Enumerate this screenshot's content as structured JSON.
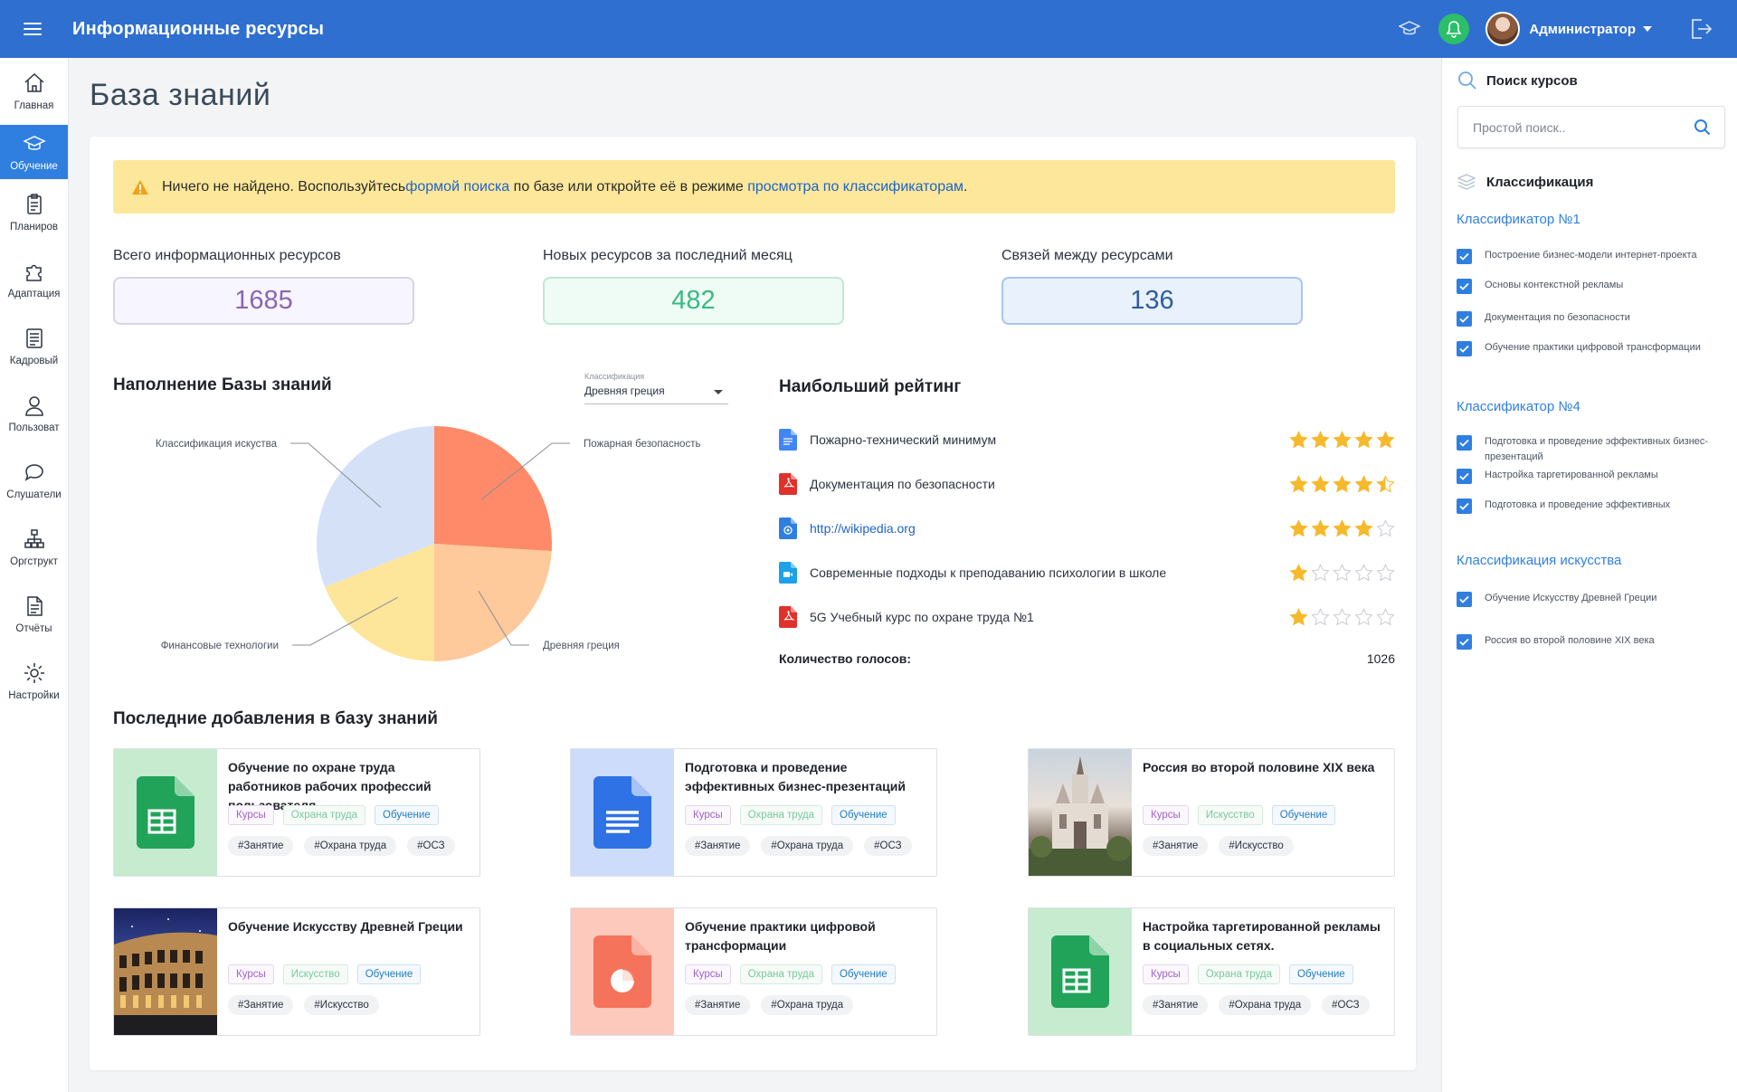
{
  "header": {
    "title": "Информационные ресурсы",
    "user_name": "Администратор"
  },
  "nav": {
    "items": [
      {
        "label": "Главная",
        "icon": "home-icon"
      },
      {
        "label": "Обучение",
        "icon": "graduation-cap-icon",
        "active": true
      },
      {
        "label": "Планиров",
        "icon": "clipboard-icon"
      },
      {
        "label": "Адаптация",
        "icon": "puzzle-icon"
      },
      {
        "label": "Кадровый",
        "icon": "document-list-icon"
      },
      {
        "label": "Пользоват",
        "icon": "user-icon"
      },
      {
        "label": "Слушатели",
        "icon": "chat-icon"
      },
      {
        "label": "Оргструкт",
        "icon": "org-chart-icon"
      },
      {
        "label": "Отчёты",
        "icon": "report-icon"
      },
      {
        "label": "Настройки",
        "icon": "gear-icon"
      }
    ]
  },
  "page": {
    "title": "База знаний"
  },
  "alert": {
    "text_before": "Ничего не найдено. Воспользуйтесь ",
    "link1": "формой поиска",
    "text_middle": " по базе или откройте её в режиме ",
    "link2": "просмотра по классификаторам",
    "text_after": "."
  },
  "stats": [
    {
      "label": "Всего информационных ресурсов",
      "value": "1685"
    },
    {
      "label": "Новых ресурсов за последний месяц",
      "value": "482"
    },
    {
      "label": "Связей между ресурсами",
      "value": "136"
    }
  ],
  "fill": {
    "title": "Наполнение Базы знаний",
    "select_label": "Классификация",
    "select_value": "Древняя греция"
  },
  "chart_data": {
    "type": "pie",
    "title": "Наполнение Базы знаний",
    "slices": [
      {
        "label": "Пожарная безопасность",
        "value": 26,
        "color": "#fe8a69"
      },
      {
        "label": "Древняя греция",
        "value": 24,
        "color": "#fec99b"
      },
      {
        "label": "Финансовые технологии",
        "value": 19,
        "color": "#fde59a"
      },
      {
        "label": "Классификация искуства",
        "value": 31,
        "color": "#d5e1f7"
      }
    ]
  },
  "rating": {
    "title": "Наибольший рейтинг",
    "items": [
      {
        "title": "Пожарно-технический минимум",
        "icon": "doc-file-icon",
        "color": "#4285f4",
        "stars": 5
      },
      {
        "title": "Документация по безопасности",
        "icon": "pdf-file-icon",
        "color": "#e0312a",
        "stars": 4.5
      },
      {
        "title": "http://wikipedia.org",
        "icon": "link-file-icon",
        "color": "#2f7fe0",
        "stars": 4,
        "link": true
      },
      {
        "title": "Современные подходы к преподаванию психологии в школе",
        "icon": "video-file-icon",
        "color": "#1da1e8",
        "stars": 1
      },
      {
        "title": "5G Учебный курс по охране труда №1",
        "icon": "pdf-file-icon",
        "color": "#e0312a",
        "stars": 1
      }
    ],
    "votes_label": "Количество голосов:",
    "votes_value": "1026"
  },
  "recent": {
    "title": "Последние добавления в базу знаний",
    "cards": [
      {
        "title": "Обучение по охране труда работников рабочих профессий пользователя",
        "thumb": "sheet",
        "tags": [
          "Курсы",
          "Охрана труда",
          "Обучение"
        ],
        "hashes": [
          "#Занятие",
          "#Охрана труда",
          "#ОСЗ"
        ]
      },
      {
        "title": "Подготовка и проведение эффективных бизнес-презентаций",
        "thumb": "doc",
        "tags": [
          "Курсы",
          "Охрана труда",
          "Обучение"
        ],
        "hashes": [
          "#Занятие",
          "#Охрана труда",
          "#ОСЗ"
        ]
      },
      {
        "title": "Россия во второй половине XIX века",
        "thumb": "photo-cathedral",
        "tags": [
          "Курсы",
          "Искусство",
          "Обучение"
        ],
        "hashes": [
          "#Занятие",
          "#Искусство"
        ]
      },
      {
        "title": "Обучение Искусству Древней Греции",
        "thumb": "photo-colosseum",
        "tags": [
          "Курсы",
          "Искусство",
          "Обучение"
        ],
        "hashes": [
          "#Занятие",
          "#Искусство"
        ]
      },
      {
        "title": "Обучение практики цифровой трансформации",
        "thumb": "slides",
        "tags": [
          "Курсы",
          "Охрана труда",
          "Обучение"
        ],
        "hashes": [
          "#Занятие",
          "#Охрана труда"
        ]
      },
      {
        "title": "Настройка таргетированной рекламы в социальных сетях.",
        "thumb": "sheet",
        "tags": [
          "Курсы",
          "Охрана труда",
          "Обучение"
        ],
        "hashes": [
          "#Занятие",
          "#Охрана труда",
          "#ОСЗ"
        ]
      }
    ]
  },
  "right": {
    "search_title": "Поиск курсов",
    "search_placeholder": "Простой поиск..",
    "classification_title": "Классификация",
    "groups": [
      {
        "title": "Классификатор №1",
        "items": [
          "Построение бизнес-модели интернет-проекта",
          "Основы контекстной рекламы",
          "Документация по безопасности",
          "Обучение практики цифровой трансформации"
        ]
      },
      {
        "title": "Классификатор №4",
        "items": [
          "Подготовка и проведение эффективных бизнес-презентаций",
          "Настройка таргетированной рекламы",
          "Подготовка и проведение эффективных"
        ]
      },
      {
        "title": "Классификация искусства",
        "items": [
          "Обучение Искусству Древней Греции",
          "Россия во второй половине XIX века"
        ]
      }
    ]
  }
}
